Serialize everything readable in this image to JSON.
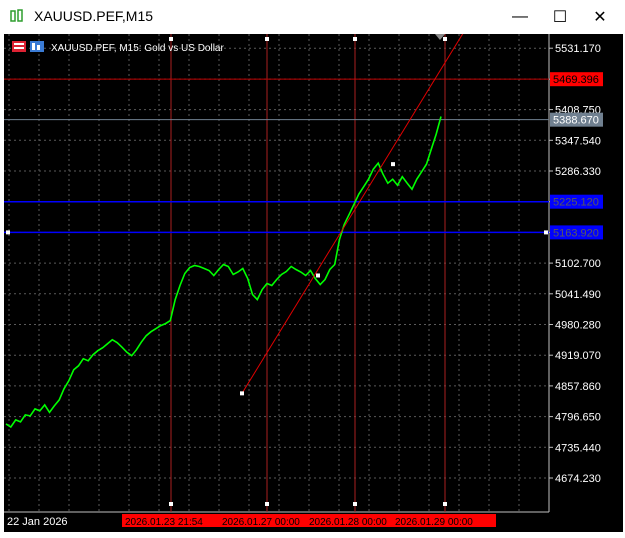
{
  "window": {
    "title": "XAUUSD.PEF,M15",
    "minimize": "—",
    "maximize": "☐",
    "close": "✕"
  },
  "header": {
    "symbol_text": "XAUUSD.PEF, M15:  Gold vs US Dollar",
    "icons": [
      "trade-panel-icon",
      "indicator-icon"
    ]
  },
  "colors": {
    "background": "#000000",
    "grid": "#5a5a5a",
    "price": "#00ff00",
    "hline_red": "#c00000",
    "hline_blue": "#0000ff",
    "current_price_line": "#708090",
    "vline": "#aa1f1f",
    "trendline": "#e00000"
  },
  "chart_data": {
    "type": "line",
    "symbol": "XAUUSD.PEF",
    "timeframe": "M15",
    "description": "Gold vs US Dollar",
    "y_range": [
      4624,
      5560
    ],
    "y_ticks": [
      "5531.170",
      "5469.396",
      "5408.750",
      "5347.540",
      "5286.330",
      "5225.120",
      "5163.920",
      "5102.700",
      "5041.490",
      "4980.280",
      "4919.070",
      "4857.860",
      "4796.650",
      "4735.440",
      "4674.230"
    ],
    "x_tick_labels": [
      "22 Jan 2026",
      "2026.01.23 21:54",
      "2026.01.27 00:00",
      "2026.01.28 00:00",
      "2026.01.29 00:00"
    ],
    "price_labels": {
      "red_line": "5469.396",
      "current_price": "5388.670",
      "blue_line_1": "5225.120",
      "blue_line_2": "5163.920"
    },
    "series": [
      {
        "name": "",
        "values": [
          4782,
          4776,
          4790,
          4786,
          4800,
          4798,
          4812,
          4808,
          4820,
          4805,
          4818,
          4830,
          4852,
          4868,
          4890,
          4898,
          4912,
          4908,
          4920,
          4928,
          4934,
          4942,
          4950,
          4944,
          4935,
          4925,
          4918,
          4930,
          4945,
          4958,
          4966,
          4972,
          4978,
          4982,
          4988,
          5030,
          5058,
          5082,
          5094,
          5098,
          5096,
          5092,
          5088,
          5078,
          5090,
          5100,
          5096,
          5080,
          5085,
          5092,
          5072,
          5040,
          5030,
          5050,
          5062,
          5058,
          5070,
          5080,
          5086,
          5096,
          5090,
          5085,
          5078,
          5088,
          5072,
          5060,
          5070,
          5090,
          5100,
          5150,
          5180,
          5200,
          5220,
          5240,
          5255,
          5270,
          5290,
          5302,
          5280,
          5262,
          5270,
          5258,
          5275,
          5262,
          5250,
          5270,
          5285,
          5300,
          5330,
          5360,
          5395
        ]
      }
    ],
    "trendline": {
      "from": [
        "2026.01.26",
        4843
      ],
      "to": [
        "2026.01.29",
        5590
      ]
    },
    "horizontal_levels": [
      5469.396,
      5225.12,
      5163.92
    ],
    "current_price": 5388.67
  }
}
